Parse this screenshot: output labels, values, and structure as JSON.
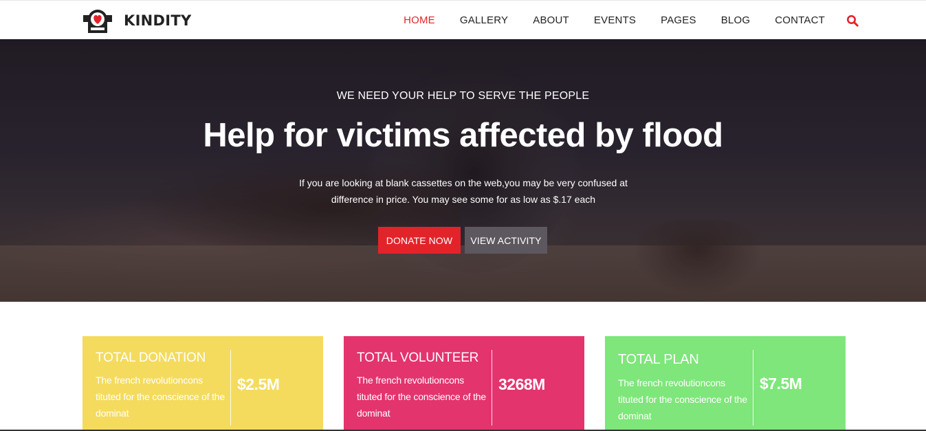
{
  "brand": {
    "name": "KINDITY"
  },
  "nav": {
    "items": [
      {
        "label": "HOME",
        "active": true
      },
      {
        "label": "GALLERY"
      },
      {
        "label": "ABOUT"
      },
      {
        "label": "EVENTS"
      },
      {
        "label": "PAGES"
      },
      {
        "label": "BLOG"
      },
      {
        "label": "CONTACT"
      }
    ],
    "search_icon": "search-icon"
  },
  "hero": {
    "kicker": "WE NEED YOUR HELP TO SERVE THE PEOPLE",
    "title": "Help for victims affected by flood",
    "description": "If you are looking at blank cassettes on the web,you may be very confused at difference in price. You may see some for as low as $.17 each",
    "buttons": {
      "donate": "DONATE NOW",
      "activity": "VIEW ACTIVITY"
    }
  },
  "stats": [
    {
      "title": "TOTAL DONATION",
      "description": "The french revolutioncons tituted for the conscience of the dominat",
      "value": "$2.5M",
      "color": "#f4db5e"
    },
    {
      "title": "TOTAL VOLUNTEER",
      "description": "The french revolutioncons tituted for the conscience of the dominat",
      "value": "3268M",
      "color": "#e3346e"
    },
    {
      "title": "TOTAL PLAN",
      "description": "The french revolutioncons tituted for the conscience of the dominat",
      "value": "$7.5M",
      "color": "#7ee67a"
    }
  ],
  "colors": {
    "accent": "#e3232a",
    "nav_text": "#222222",
    "secondary_button": "#5d585f"
  }
}
